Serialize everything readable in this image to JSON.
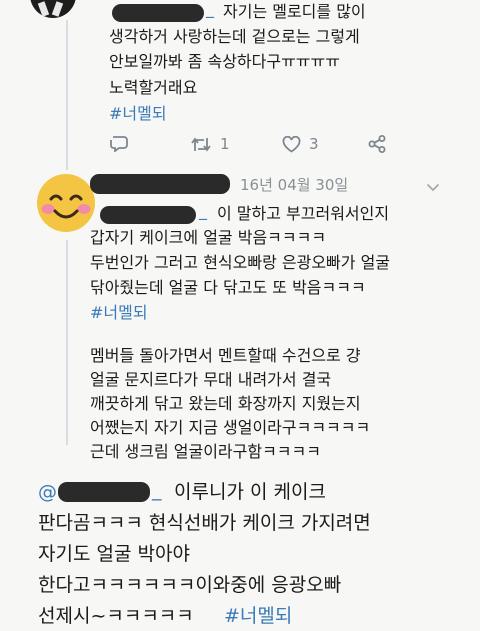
{
  "tweet1": {
    "mention_suffix": "_",
    "lines": [
      "자기는 멜로디를 많이",
      "생각하거 사랑하는데 겉으로는 그렇게",
      "안보일까봐 좀 속상하다구ㅠㅠㅠㅠ",
      "노력할거래요"
    ],
    "hashtag": "#너멜되",
    "actions": {
      "reply_count": "",
      "retweet_count": "1",
      "like_count": "3"
    }
  },
  "tweet2": {
    "date": "16년 04월 30일",
    "mention_suffix": "_",
    "first_line_rest": "이 말하고 부끄러워서인지",
    "lines": [
      "갑자기 케이크에 얼굴 박음ㅋㅋㅋㅋ",
      "두번인가 그러고 현식오빠랑 은광오빠가 얼굴",
      "닦아줬는데 얼굴 다 닦고도 또 박음ㅋㅋㅋ"
    ],
    "hashtag": "#너멜되",
    "para2": [
      "멤버들 돌아가면서 멘트할때 수건으로 걍",
      "얼굴 문지르다가 무대 내려가서 결국",
      "깨끗하게 닦고 왔는데 화장까지 지웠는지",
      "어쨌는지 자기 지금 생얼이라구ㅋㅋㅋㅋㅋ",
      "근데 생크림 얼굴이라구함ㅋㅋㅋㅋ"
    ]
  },
  "tweet3": {
    "at_sign": "@",
    "mention_suffix": "_",
    "first_line_rest": "이루니가 이 케이크",
    "lines": [
      "판다곰ㅋㅋㅋ 현식선배가 케이크 가지려면",
      "자기도 얼굴 박아야",
      "한다고ㅋㅋㅋㅋㅋㅋ이와중에 응광오빠"
    ],
    "last_line_text": "선제시~ㅋㅋㅋㅋㅋ",
    "hashtag": "#너멜되"
  },
  "colors": {
    "link": "#3a7bb8",
    "redaction": "#2a2a2a",
    "emoji_face": "#f4c542",
    "emoji_cheeks": "#f28ba8"
  },
  "icons": [
    "reply-icon",
    "retweet-icon",
    "heart-icon",
    "share-icon",
    "chevron-down-icon",
    "smiling-face-emoji"
  ]
}
